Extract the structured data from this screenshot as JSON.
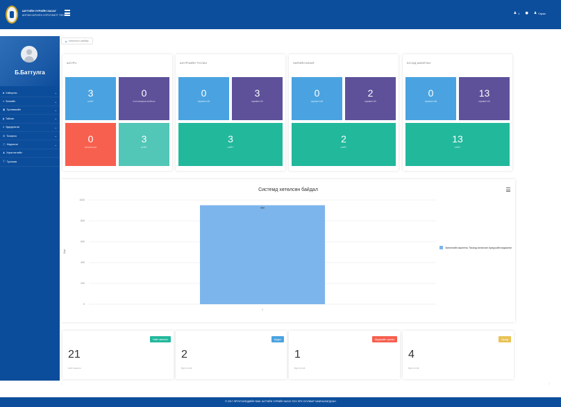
{
  "header": {
    "brand_line1": "ШУТИЙН УУРИЙН ЗАСАГ",
    "brand_line2": "ШУГАМ БАРИЛГА ХЭРЭГЖИЛТ ТӨСӨЛ",
    "icons": [
      "user-icon",
      "lock-icon",
      "user-icon"
    ],
    "bell_count": "1",
    "logout_label": "Гарах"
  },
  "sidebar": {
    "username": "Б.Баттулга",
    "items": [
      {
        "label": "Хэйнусны",
        "icon": "grid-icon",
        "has_children": true
      },
      {
        "label": "Зээлийн",
        "icon": "list-icon",
        "has_children": true
      },
      {
        "label": "Тусламжийн",
        "icon": "book-icon",
        "has_children": true
      },
      {
        "label": "Тайлан",
        "icon": "chart-icon",
        "has_children": true
      },
      {
        "label": "Удирдлагын",
        "icon": "users-icon",
        "has_children": true
      },
      {
        "label": "Тохиргоо",
        "icon": "gear-icon",
        "has_children": true
      },
      {
        "label": "Мэдээлэл",
        "icon": "info-icon",
        "has_children": true
      },
      {
        "label": "Хэрэглэгчийн",
        "icon": "user-icon",
        "has_children": false
      },
      {
        "label": "Тусламж",
        "icon": "help-icon",
        "has_children": false
      }
    ]
  },
  "breadcrumb": {
    "label": "Хяналтын самбар"
  },
  "panels": [
    {
      "title": "ШУУРЧ",
      "tiles": [
        {
          "value": "3",
          "caption": "НИЙТ"
        },
        {
          "value": "0",
          "caption": "ХҮЛЭЭГДЭЖ БАЙГАА"
        },
        {
          "value": "0",
          "caption": "ЦУЦЛАСАН"
        },
        {
          "value": "3",
          "caption": "НИЙТ"
        }
      ]
    },
    {
      "title": "ШУУРЧИЙН ТҮСЛАХ",
      "tiles": [
        {
          "value": "0",
          "caption": "ИДЭВХТЭЙ"
        },
        {
          "value": "3",
          "caption": "ИДЭВХГҮЙ"
        },
        {
          "value": "3",
          "caption": "НИЙТ"
        }
      ]
    },
    {
      "title": "НАРИЙН БИЧИГ",
      "tiles": [
        {
          "value": "0",
          "caption": "ИДЭВХТЭЙ"
        },
        {
          "value": "2",
          "caption": "ИДЭВХГҮЙ"
        },
        {
          "value": "2",
          "caption": "НИЙТ"
        }
      ]
    },
    {
      "title": "БУСАД АЖИЛТАН",
      "tiles": [
        {
          "value": "0",
          "caption": "ИДЭВХТЭЙ"
        },
        {
          "value": "13",
          "caption": "ИДЭВХГҮЙ"
        },
        {
          "value": "13",
          "caption": "НИЙТ"
        }
      ]
    }
  ],
  "colors": {
    "blue": "#4aa3e0",
    "purple": "#5e519a",
    "red": "#f7604f",
    "teal": "#52c6b7",
    "green": "#22b89c",
    "header": "#0d4e9c",
    "bar": "#7cb5ec"
  },
  "chart_data": {
    "type": "bar",
    "title": "Системд хөтөлсөн байдал",
    "ylabel": "Хүн",
    "categories": [
      "1"
    ],
    "ylim": [
      0,
      1000
    ],
    "y_ticks": [
      "0",
      "200",
      "400",
      "600",
      "800",
      "1000"
    ],
    "series": [
      {
        "name": "Эмнэлгийн ажилтны Төсөлд хөтөлсөн хүмүүсийн мэдээлэл",
        "values": [
          950
        ],
        "labels": [
          "950"
        ]
      }
    ],
    "legend": "right",
    "grid": true
  },
  "stats": [
    {
      "value": "21",
      "sub": "Нийт эмнэлэг",
      "badge": "Нийт эмнэлэг",
      "badge_color": "#22b89c"
    },
    {
      "value": "2",
      "sub": "Бүртгэлтэй",
      "badge": "Шуурч",
      "badge_color": "#4aa3e0"
    },
    {
      "value": "1",
      "sub": "Бүртгэлтэй",
      "badge": "Шуурчийн туслах",
      "badge_color": "#f7604f"
    },
    {
      "value": "4",
      "sub": "Бүртгэлтэй",
      "badge": "Бусад",
      "badge_color": "#e8c354"
    }
  ],
  "footer": {
    "text": "© 2017 ЭРҮҮЛ МЭНДИЙН ЯАМ. ШУТИЙН УУРИЙН ЗАСАГ. БҮХ ЭРХ ХУУЛИАР ХАМГААЛАГДСАН"
  }
}
